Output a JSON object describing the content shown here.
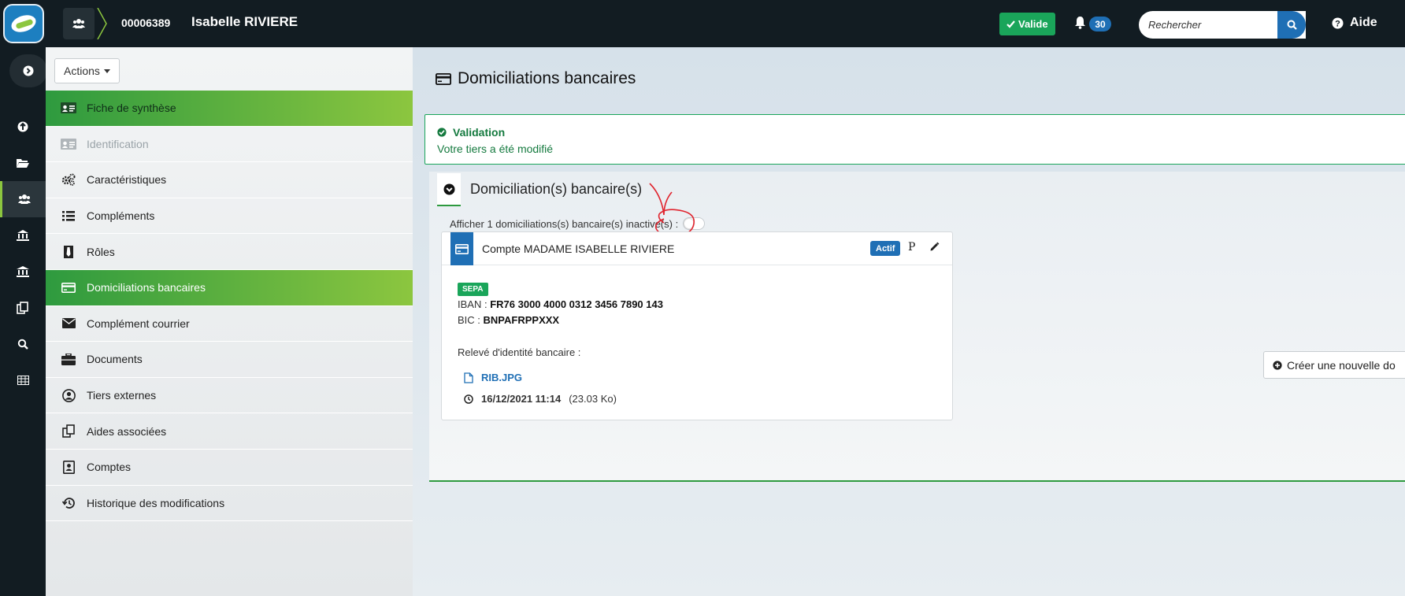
{
  "topbar": {
    "record_id": "00006389",
    "record_name": "Isabelle RIVIERE",
    "status_label": "Valide",
    "notification_count": "30",
    "search_placeholder": "Rechercher",
    "help_label": "Aide"
  },
  "rail": {
    "items": [
      "info-icon",
      "folder-icon",
      "users-icon",
      "court-icon",
      "bank-icon",
      "copy-icon",
      "search-icon",
      "table-icon"
    ],
    "active_index": 2
  },
  "nav": {
    "actions_label": "Actions",
    "items": [
      {
        "label": "Fiche de synthèse",
        "icon": "id-card-icon"
      },
      {
        "label": "Identification",
        "icon": "id-card-icon"
      },
      {
        "label": "Caractéristiques",
        "icon": "gears-icon"
      },
      {
        "label": "Compléments",
        "icon": "list-icon"
      },
      {
        "label": "Rôles",
        "icon": "tie-icon"
      },
      {
        "label": "Domiciliations bancaires",
        "icon": "credit-card-icon"
      },
      {
        "label": "Complément courrier",
        "icon": "envelope-icon"
      },
      {
        "label": "Documents",
        "icon": "briefcase-icon"
      },
      {
        "label": "Tiers externes",
        "icon": "user-circle-icon"
      },
      {
        "label": "Aides associées",
        "icon": "copy-icon"
      },
      {
        "label": "Comptes",
        "icon": "contact-card-icon"
      },
      {
        "label": "Historique des modifications",
        "icon": "history-icon"
      }
    ]
  },
  "main": {
    "page_title": "Domiciliations bancaires",
    "alert": {
      "title": "Validation",
      "message": "Votre tiers a été modifié"
    },
    "panel": {
      "title": "Domiciliation(s) bancaire(s)",
      "toggle_label": "Afficher 1 domiciliations(s) bancaire(s) inactive(s) :",
      "toggle_on": false
    },
    "card": {
      "title": "Compte MADAME ISABELLE RIVIERE",
      "status_badge": "Actif",
      "p_marker": "P",
      "sepa_badge": "SEPA",
      "iban_label": "IBAN :",
      "iban_value": "FR76 3000 4000 0312 3456 7890 143",
      "bic_label": "BIC :",
      "bic_value": "BNPAFRPPXXX",
      "rib_label": "Relevé d'identité bancaire :",
      "file_name": "RIB.JPG",
      "file_date": "16/12/2021 11:14",
      "file_size": "(23.03 Ko)"
    },
    "create_button": "Créer une nouvelle do"
  },
  "colors": {
    "topbar_bg": "#121c22",
    "accent_green": "#1aa55a",
    "nav_active_gradient_start": "#2e9a3f",
    "nav_active_gradient_end": "#8cc63f",
    "primary_blue": "#1f6fb5",
    "annotation_red": "#e0232d"
  }
}
